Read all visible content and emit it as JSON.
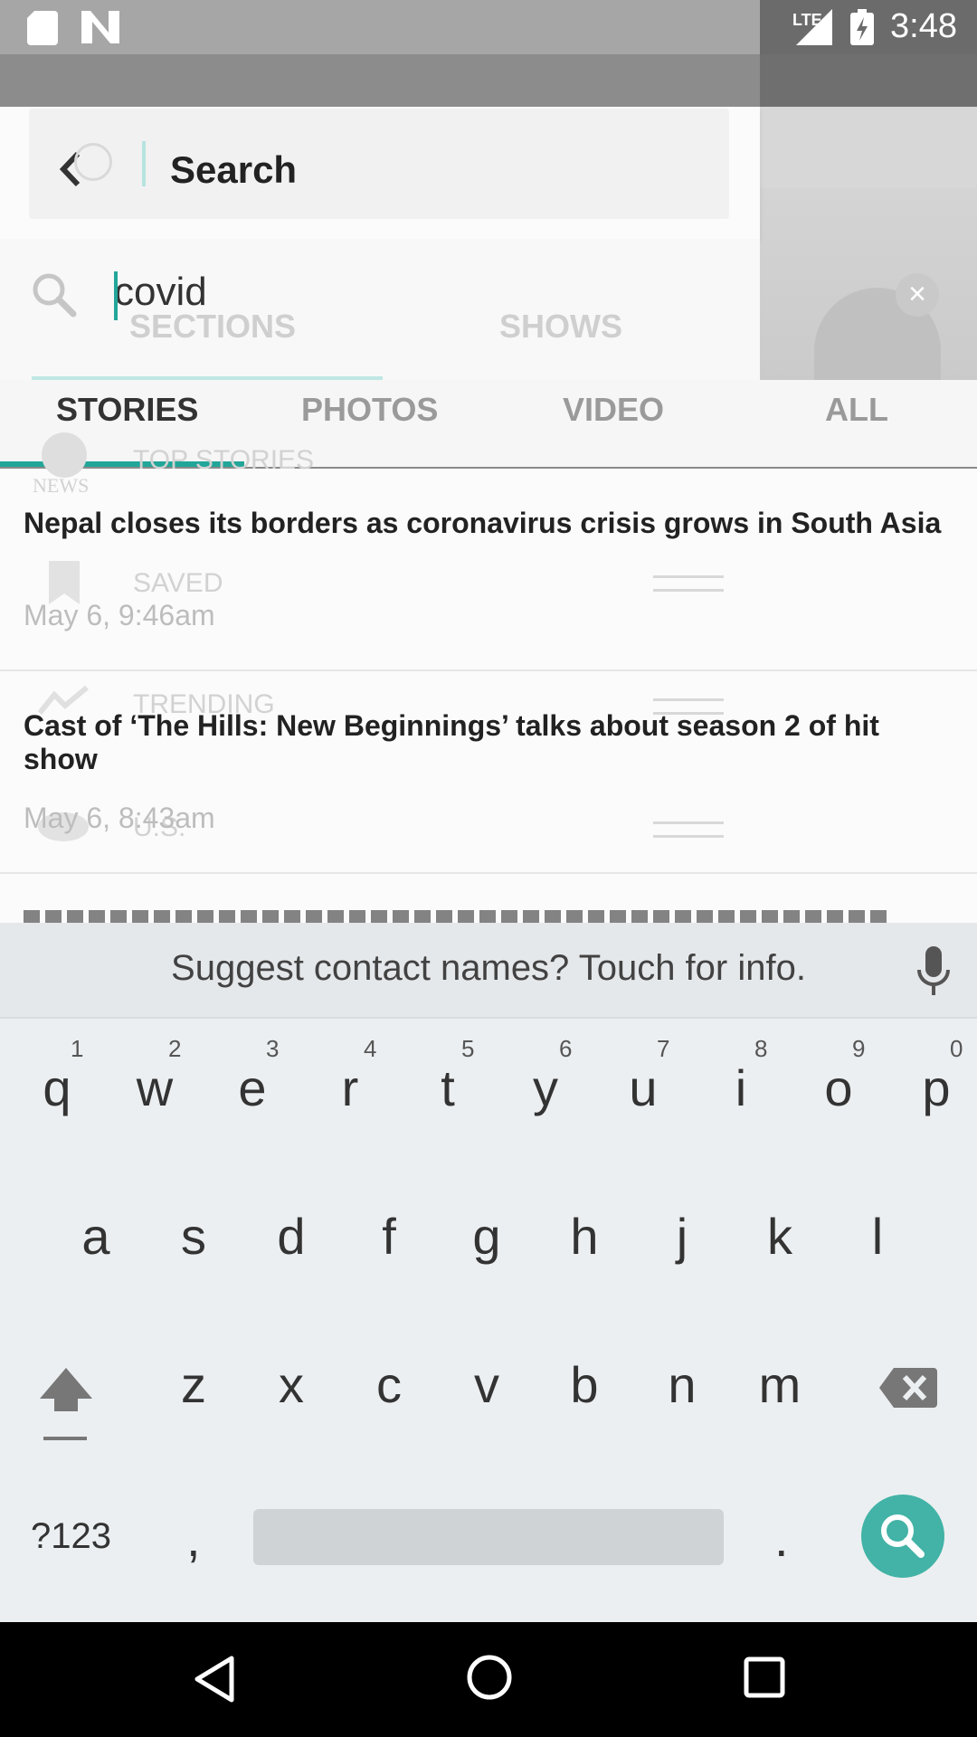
{
  "status_bar": {
    "time": "3:48",
    "network": "LTE"
  },
  "header": {
    "title": "Search",
    "ghost_placeholder": "Search"
  },
  "search": {
    "value": "covid"
  },
  "ghost_menu": {
    "sections_tab": "SECTIONS",
    "shows_tab": "SHOWS",
    "items": [
      "TOP STORIES",
      "SAVED",
      "TRENDING",
      "U.S."
    ],
    "abc_news": "NEWS"
  },
  "tabs": [
    {
      "label": "STORIES",
      "active": true
    },
    {
      "label": "PHOTOS",
      "active": false
    },
    {
      "label": "VIDEO",
      "active": false
    },
    {
      "label": "ALL",
      "active": false
    }
  ],
  "results": [
    {
      "title": "Nepal closes its borders as coronavirus crisis grows in South Asia",
      "date": "May 6, 9:46am"
    },
    {
      "title": "Cast of ‘The Hills: New Beginnings’ talks about season 2 of hit show",
      "date": "May 6, 8:43am"
    }
  ],
  "keyboard": {
    "suggestion": "Suggest contact names? Touch for info.",
    "row1": [
      "q",
      "w",
      "e",
      "r",
      "t",
      "y",
      "u",
      "i",
      "o",
      "p"
    ],
    "row1_nums": [
      "1",
      "2",
      "3",
      "4",
      "5",
      "6",
      "7",
      "8",
      "9",
      "0"
    ],
    "row2": [
      "a",
      "s",
      "d",
      "f",
      "g",
      "h",
      "j",
      "k",
      "l"
    ],
    "row3": [
      "z",
      "x",
      "c",
      "v",
      "b",
      "n",
      "m"
    ],
    "symbols_key": "?123",
    "comma_key": ",",
    "period_key": "."
  },
  "colors": {
    "accent": "#21a699",
    "fab": "#42b3a6"
  }
}
